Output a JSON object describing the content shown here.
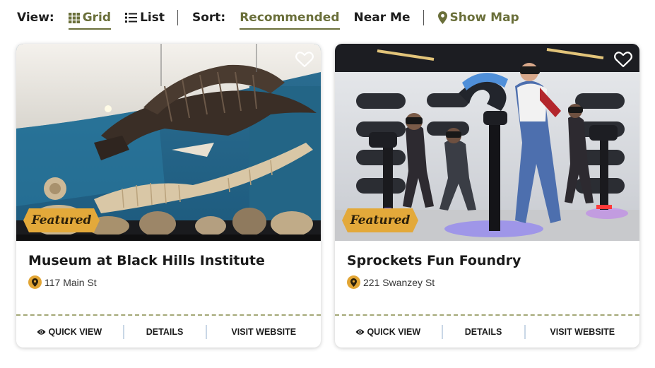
{
  "toolbar": {
    "view_label": "View:",
    "view_options": [
      {
        "label": "Grid",
        "active": true,
        "icon": "grid-icon"
      },
      {
        "label": "List",
        "active": false,
        "icon": "list-icon"
      }
    ],
    "sort_label": "Sort:",
    "sort_options": [
      {
        "label": "Recommended",
        "active": true
      },
      {
        "label": "Near Me",
        "active": false
      }
    ],
    "map_link": {
      "label": "Show Map",
      "icon": "map-pin-icon"
    }
  },
  "colors": {
    "accent": "#6a6f3a",
    "featured_badge": "#e3a93a",
    "pin": "#e2a534",
    "divider": "#a4a877",
    "action_separator": "#c9d7e6"
  },
  "cards": [
    {
      "title": "Museum at Black Hills Institute",
      "address": "117 Main St",
      "badge": "Featured",
      "image": "museum-fossil-exhibit-photo",
      "actions": {
        "quick_view": "QUICK VIEW",
        "details": "DETAILS",
        "visit": "VISIT WEBSITE"
      }
    },
    {
      "title": "Sprockets Fun Foundry",
      "address": "221 Swanzey St",
      "badge": "Featured",
      "image": "vr-arcade-riders-photo",
      "actions": {
        "quick_view": "QUICK VIEW",
        "details": "DETAILS",
        "visit": "VISIT WEBSITE"
      }
    }
  ]
}
